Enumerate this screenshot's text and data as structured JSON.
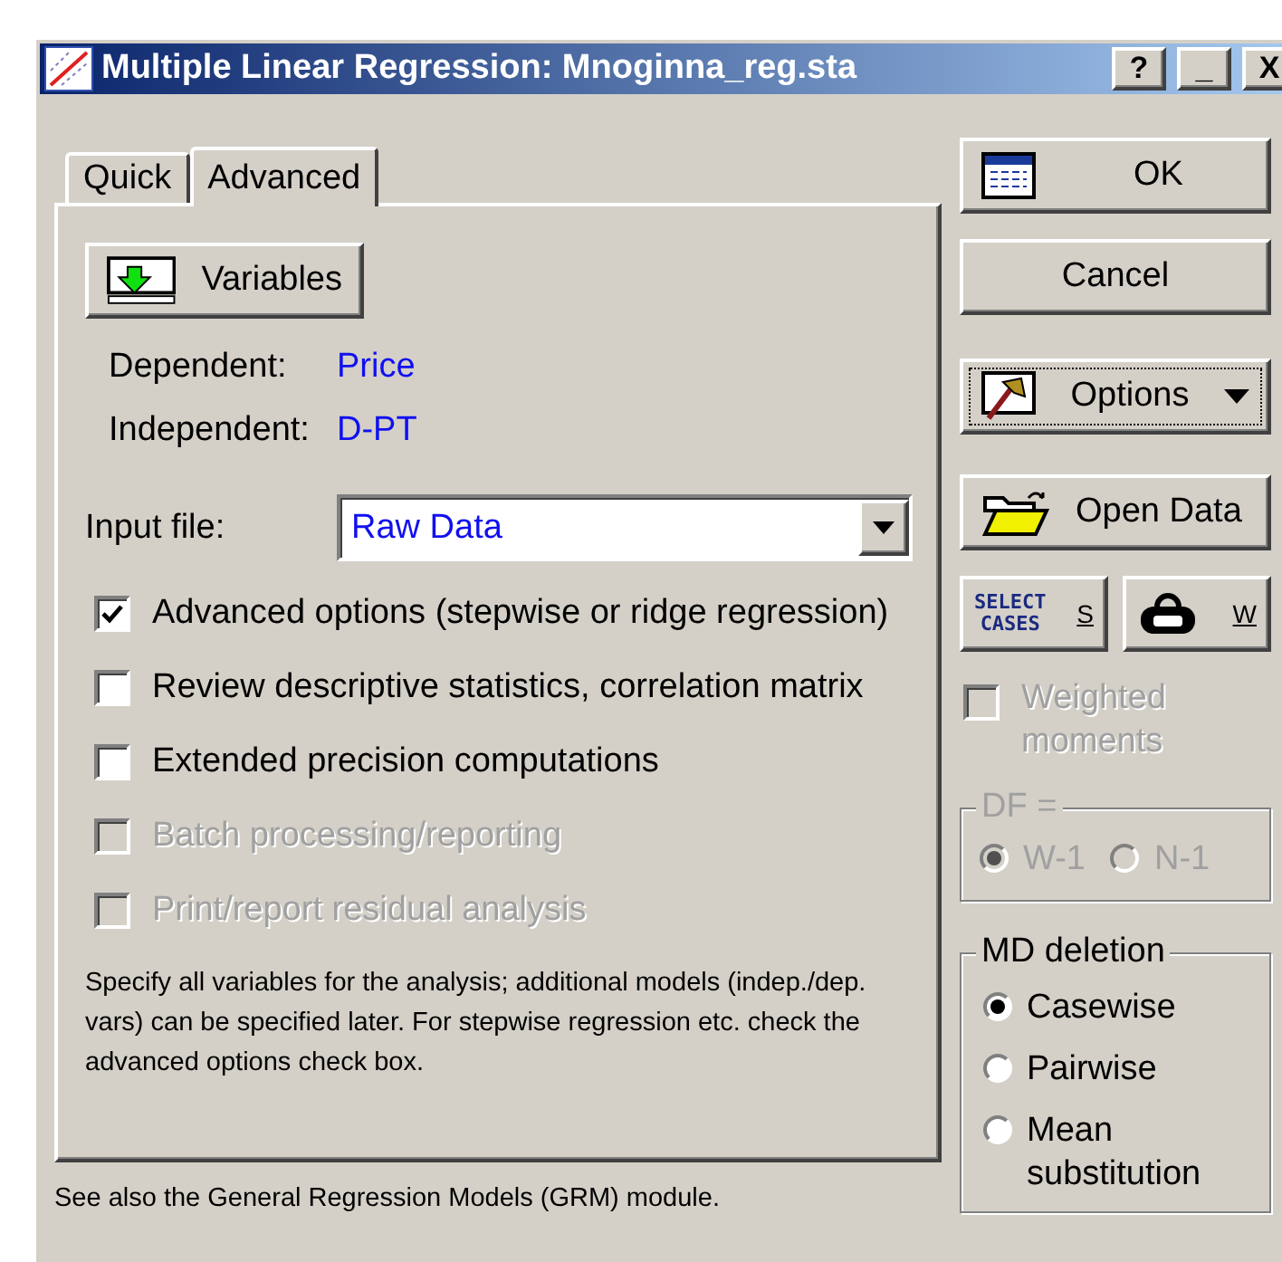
{
  "window": {
    "title": "Multiple Linear Regression: Mnoginna_reg.sta",
    "controls": [
      "?",
      "_",
      "X"
    ]
  },
  "tabs": [
    {
      "label": "Quick",
      "selected": false
    },
    {
      "label": "Advanced",
      "selected": true
    }
  ],
  "variables_button": "Variables",
  "variables": [
    {
      "label": "Dependent:",
      "value": "Price"
    },
    {
      "label": "Independent:",
      "value": "D-PT"
    }
  ],
  "input_file": {
    "label": "Input file:",
    "value": "Raw Data"
  },
  "checkboxes": [
    {
      "label": "Advanced options (stepwise or ridge regression)",
      "checked": true,
      "disabled": false
    },
    {
      "label": "Review descriptive statistics, correlation matrix",
      "checked": false,
      "disabled": false
    },
    {
      "label": "Extended precision computations",
      "checked": false,
      "disabled": false
    },
    {
      "label": "Batch processing/reporting",
      "checked": false,
      "disabled": true
    },
    {
      "label": "Print/report residual analysis",
      "checked": false,
      "disabled": true
    }
  ],
  "note": "Specify all variables for the analysis; additional models (indep./dep. vars) can be specified later.  For stepwise regression etc. check the advanced options check box.",
  "footer": "See also the General Regression Models (GRM) module.",
  "buttons": {
    "ok": "OK",
    "cancel": "Cancel",
    "options": "Options",
    "open_data": "Open Data",
    "select_cases": [
      "SELECT",
      "CASES"
    ],
    "select_cases_key": "S",
    "weight_key": "W"
  },
  "weighted": {
    "label": "Weighted moments",
    "checked": false,
    "disabled": true
  },
  "df_group": {
    "title": "DF =",
    "disabled": true,
    "options": [
      {
        "label": "W-1",
        "selected": true
      },
      {
        "label": "N-1",
        "selected": false
      }
    ]
  },
  "md_group": {
    "title": "MD deletion",
    "disabled": false,
    "options": [
      {
        "label": "Casewise",
        "selected": true
      },
      {
        "label": "Pairwise",
        "selected": false
      },
      {
        "label": "Mean substitution",
        "selected": false
      }
    ]
  }
}
